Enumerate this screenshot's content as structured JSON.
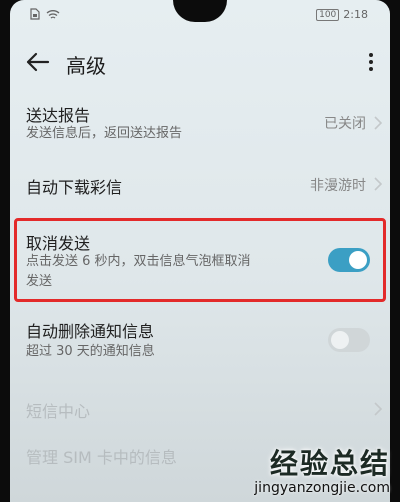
{
  "status_bar": {
    "battery": "100",
    "time": "2:18"
  },
  "header": {
    "title": "高级"
  },
  "rows": [
    {
      "title": "送达报告",
      "subtitle": "发送信息后，返回送达报告",
      "value": "已关闭"
    },
    {
      "title": "自动下载彩信",
      "value": "非漫游时"
    },
    {
      "title": "取消发送",
      "subtitle_line1": "点击发送 6 秒内，双击信息气泡框取消",
      "subtitle_line2": "发送",
      "toggle": "on"
    },
    {
      "title": "自动删除通知信息",
      "subtitle": "超过 30 天的通知信息",
      "toggle": "off"
    },
    {
      "title": "短信中心"
    },
    {
      "title": "管理 SIM 卡中的信息"
    }
  ],
  "highlight_color": "#e32a2a",
  "toggle_on_color": "#3b9fc4",
  "watermark": {
    "chinese": "经验总结",
    "url": "jingyanzongjie.com"
  }
}
